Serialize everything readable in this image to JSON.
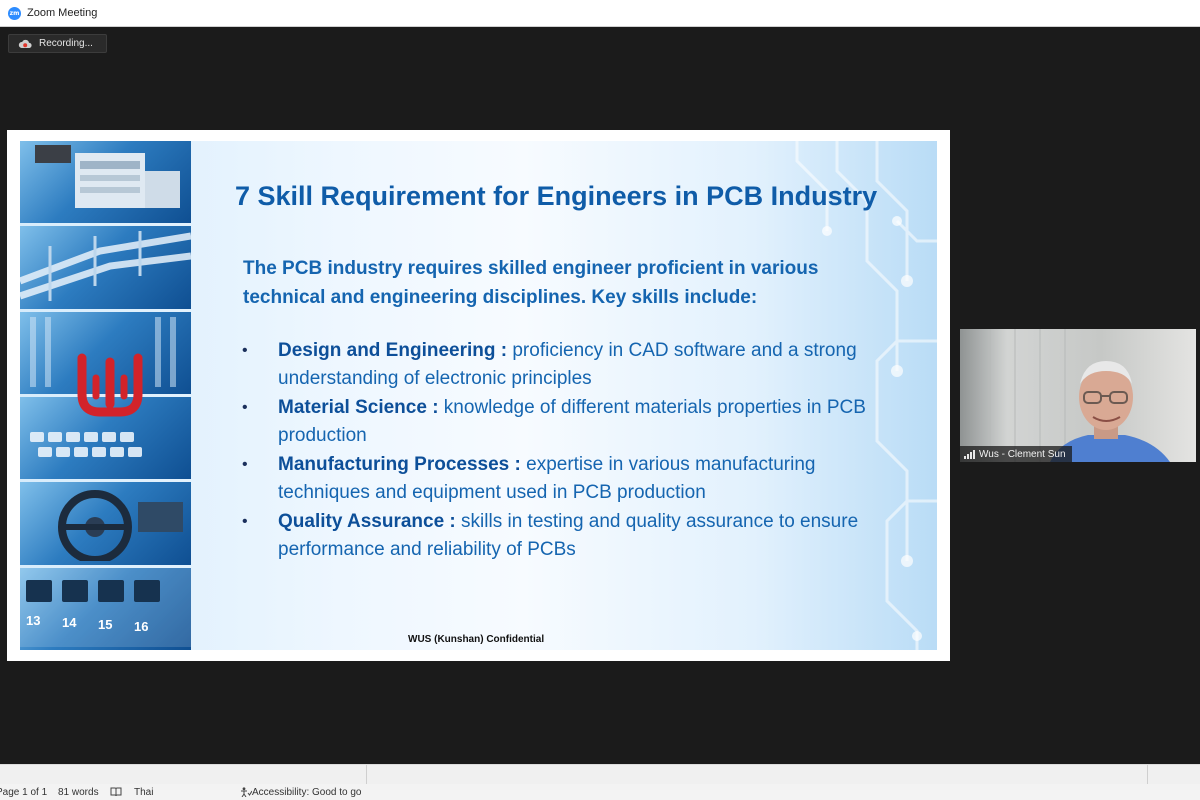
{
  "window": {
    "title": "Zoom Meeting",
    "app_icon": "zoom-logo-icon"
  },
  "recording": {
    "label": "Recording...",
    "icon": "cloud-recording-icon"
  },
  "slide": {
    "title": "7  Skill Requirement for Engineers in PCB Industry",
    "intro": "The PCB industry requires skilled engineer proficient in various technical and engineering disciplines. Key skills include:",
    "bullets": [
      {
        "label": "Design and Engineering :",
        "text": " proficiency in CAD software and a strong understanding of electronic principles"
      },
      {
        "label": "Material Science :",
        "text": " knowledge of different materials properties in PCB production"
      },
      {
        "label": "Manufacturing Processes :",
        "text": " expertise in various manufacturing techniques and equipment used in PCB production"
      },
      {
        "label": "Quality Assurance :",
        "text": " skills in testing and quality assurance to ensure  performance and reliability of PCBs"
      }
    ],
    "bullet_glyph": "•",
    "footer": "WUS (Kunshan) Confidential",
    "port_numbers": [
      "13",
      "14",
      "15",
      "16"
    ],
    "colors": {
      "title": "#0f5ca8",
      "body": "#1565b0",
      "logo_red": "#d2232a"
    }
  },
  "participant": {
    "name": "Wus - Clement Sun",
    "icon": "signal-strength-icon"
  },
  "statusbar": {
    "page": "Page 1 of 1",
    "words": "81 words",
    "language": "Thai",
    "accessibility": "Accessibility: Good to go"
  }
}
